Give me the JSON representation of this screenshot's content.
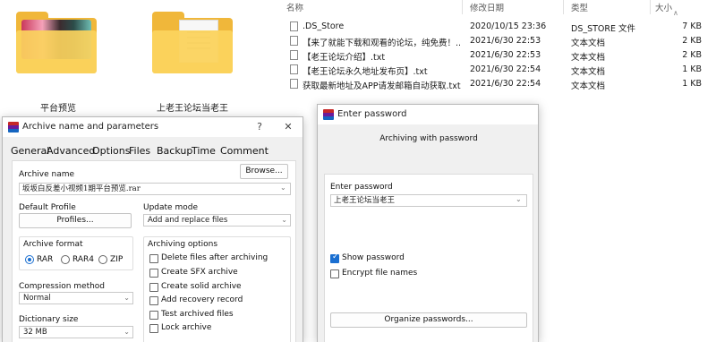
{
  "explorer": {
    "folders": [
      {
        "label": "平台预览"
      },
      {
        "label": "上老王论坛当老王"
      }
    ],
    "columns": {
      "name": "名称",
      "date": "修改日期",
      "type": "类型",
      "size": "大小"
    },
    "files": [
      {
        "name": ".DS_Store",
        "date": "2020/10/15 23:36",
        "type": "DS_STORE 文件",
        "size": "7 KB"
      },
      {
        "name": "【来了就能下载和观看的论坛，纯免费！...",
        "date": "2021/6/30 22:53",
        "type": "文本文档",
        "size": "2 KB"
      },
      {
        "name": "【老王论坛介绍】.txt",
        "date": "2021/6/30 22:53",
        "type": "文本文档",
        "size": "2 KB"
      },
      {
        "name": "【老王论坛永久地址发布页】.txt",
        "date": "2021/6/30 22:54",
        "type": "文本文档",
        "size": "1 KB"
      },
      {
        "name": "获取最新地址及APP请发邮箱自动获取.txt",
        "date": "2021/6/30 22:54",
        "type": "文本文档",
        "size": "1 KB"
      }
    ]
  },
  "archive_dialog": {
    "title": "Archive name and parameters",
    "help": "?",
    "close": "✕",
    "tabs": [
      "General",
      "Advanced",
      "Options",
      "Files",
      "Backup",
      "Time",
      "Comment"
    ],
    "archive_name_label": "Archive name",
    "archive_name_value": "坂坂白反差小视频1期平台预览.rar",
    "browse_label": "Browse...",
    "default_profile_label": "Default Profile",
    "profiles_label": "Profiles...",
    "update_mode_label": "Update mode",
    "update_mode_value": "Add and replace files",
    "archive_format_label": "Archive format",
    "formats": [
      {
        "label": "RAR",
        "checked": true
      },
      {
        "label": "RAR4",
        "checked": false
      },
      {
        "label": "ZIP",
        "checked": false
      }
    ],
    "compression_method_label": "Compression method",
    "compression_method_value": "Normal",
    "dictionary_size_label": "Dictionary size",
    "dictionary_size_value": "32 MB",
    "archiving_options_label": "Archiving options",
    "options": [
      {
        "label": "Delete files after archiving",
        "checked": false
      },
      {
        "label": "Create SFX archive",
        "checked": false
      },
      {
        "label": "Create solid archive",
        "checked": false
      },
      {
        "label": "Add recovery record",
        "checked": false
      },
      {
        "label": "Test archived files",
        "checked": false
      },
      {
        "label": "Lock archive",
        "checked": false
      }
    ]
  },
  "password_dialog": {
    "title": "Enter password",
    "heading": "Archiving with password",
    "enter_password_label": "Enter password",
    "password_value": "上老王论坛当老王",
    "show_password": {
      "label": "Show password",
      "checked": true
    },
    "encrypt_names": {
      "label": "Encrypt file names",
      "checked": false
    },
    "organize_label": "Organize passwords..."
  }
}
